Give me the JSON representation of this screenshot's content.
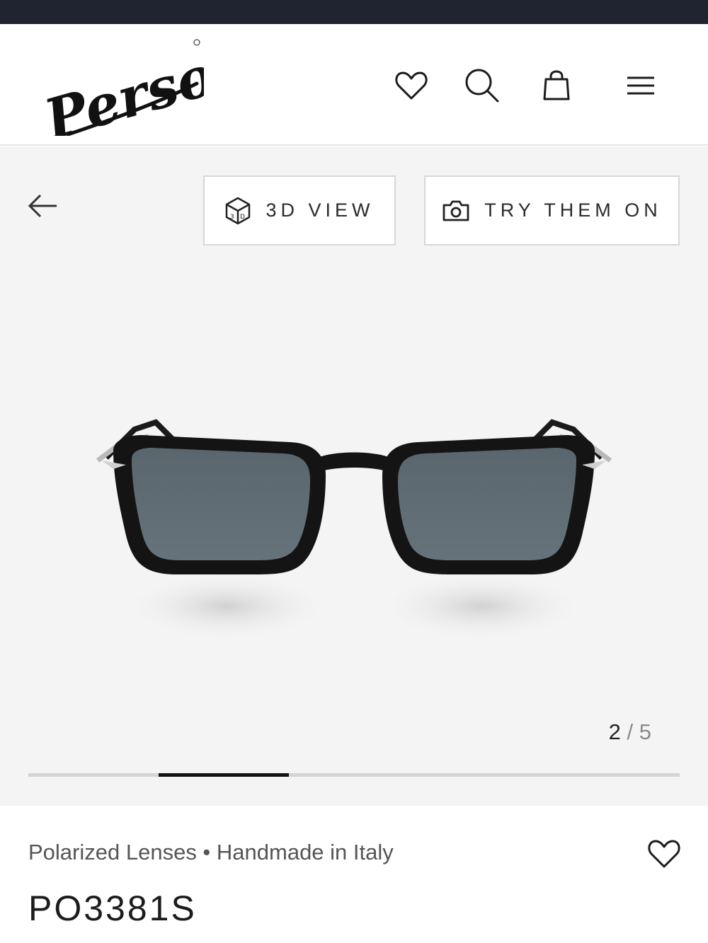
{
  "header": {
    "logo_text": "Persol",
    "icons": [
      "heart-icon",
      "search-icon",
      "shopping-bag-icon",
      "hamburger-menu-icon"
    ]
  },
  "gallery": {
    "back_icon": "arrow-left-icon",
    "view_3d_label": "3D VIEW",
    "view_3d_icon": "3d-cube-icon",
    "try_on_label": "TRY THEM ON",
    "try_on_icon": "camera-icon",
    "current_index": "2",
    "separator": "/",
    "total": "5",
    "progress_fraction": 0.2,
    "product_image_alt": "Black sunglasses with blue polarized lenses, front view"
  },
  "product": {
    "features": "Polarized Lenses • Handmade in Italy",
    "model": "PO3381S",
    "favorite_icon": "heart-icon"
  },
  "colors": {
    "status_bar": "#1f2430",
    "gallery_bg": "#f4f4f4",
    "progress_active": "#111111",
    "progress_track": "#d5d5d5"
  }
}
